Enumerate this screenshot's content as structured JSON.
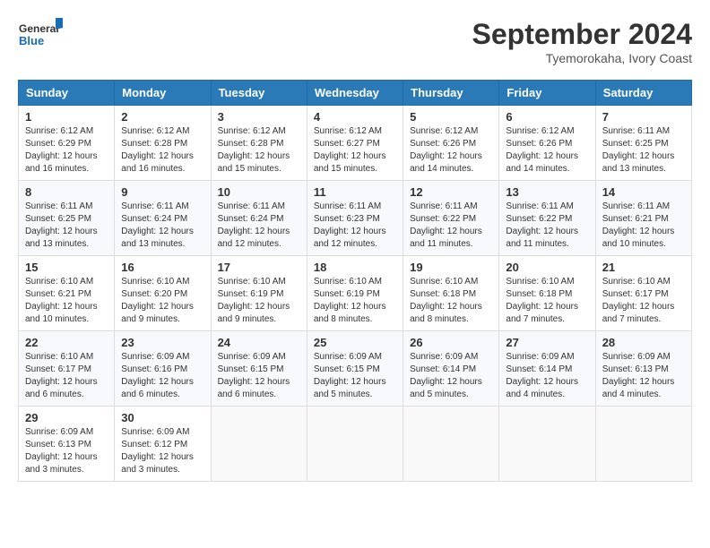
{
  "header": {
    "logo_line1": "General",
    "logo_line2": "Blue",
    "main_title": "September 2024",
    "subtitle": "Tyemorokaha, Ivory Coast"
  },
  "calendar": {
    "days_of_week": [
      "Sunday",
      "Monday",
      "Tuesday",
      "Wednesday",
      "Thursday",
      "Friday",
      "Saturday"
    ],
    "weeks": [
      [
        {
          "day": "1",
          "info": "Sunrise: 6:12 AM\nSunset: 6:29 PM\nDaylight: 12 hours\nand 16 minutes."
        },
        {
          "day": "2",
          "info": "Sunrise: 6:12 AM\nSunset: 6:28 PM\nDaylight: 12 hours\nand 16 minutes."
        },
        {
          "day": "3",
          "info": "Sunrise: 6:12 AM\nSunset: 6:28 PM\nDaylight: 12 hours\nand 15 minutes."
        },
        {
          "day": "4",
          "info": "Sunrise: 6:12 AM\nSunset: 6:27 PM\nDaylight: 12 hours\nand 15 minutes."
        },
        {
          "day": "5",
          "info": "Sunrise: 6:12 AM\nSunset: 6:26 PM\nDaylight: 12 hours\nand 14 minutes."
        },
        {
          "day": "6",
          "info": "Sunrise: 6:12 AM\nSunset: 6:26 PM\nDaylight: 12 hours\nand 14 minutes."
        },
        {
          "day": "7",
          "info": "Sunrise: 6:11 AM\nSunset: 6:25 PM\nDaylight: 12 hours\nand 13 minutes."
        }
      ],
      [
        {
          "day": "8",
          "info": "Sunrise: 6:11 AM\nSunset: 6:25 PM\nDaylight: 12 hours\nand 13 minutes."
        },
        {
          "day": "9",
          "info": "Sunrise: 6:11 AM\nSunset: 6:24 PM\nDaylight: 12 hours\nand 13 minutes."
        },
        {
          "day": "10",
          "info": "Sunrise: 6:11 AM\nSunset: 6:24 PM\nDaylight: 12 hours\nand 12 minutes."
        },
        {
          "day": "11",
          "info": "Sunrise: 6:11 AM\nSunset: 6:23 PM\nDaylight: 12 hours\nand 12 minutes."
        },
        {
          "day": "12",
          "info": "Sunrise: 6:11 AM\nSunset: 6:22 PM\nDaylight: 12 hours\nand 11 minutes."
        },
        {
          "day": "13",
          "info": "Sunrise: 6:11 AM\nSunset: 6:22 PM\nDaylight: 12 hours\nand 11 minutes."
        },
        {
          "day": "14",
          "info": "Sunrise: 6:11 AM\nSunset: 6:21 PM\nDaylight: 12 hours\nand 10 minutes."
        }
      ],
      [
        {
          "day": "15",
          "info": "Sunrise: 6:10 AM\nSunset: 6:21 PM\nDaylight: 12 hours\nand 10 minutes."
        },
        {
          "day": "16",
          "info": "Sunrise: 6:10 AM\nSunset: 6:20 PM\nDaylight: 12 hours\nand 9 minutes."
        },
        {
          "day": "17",
          "info": "Sunrise: 6:10 AM\nSunset: 6:19 PM\nDaylight: 12 hours\nand 9 minutes."
        },
        {
          "day": "18",
          "info": "Sunrise: 6:10 AM\nSunset: 6:19 PM\nDaylight: 12 hours\nand 8 minutes."
        },
        {
          "day": "19",
          "info": "Sunrise: 6:10 AM\nSunset: 6:18 PM\nDaylight: 12 hours\nand 8 minutes."
        },
        {
          "day": "20",
          "info": "Sunrise: 6:10 AM\nSunset: 6:18 PM\nDaylight: 12 hours\nand 7 minutes."
        },
        {
          "day": "21",
          "info": "Sunrise: 6:10 AM\nSunset: 6:17 PM\nDaylight: 12 hours\nand 7 minutes."
        }
      ],
      [
        {
          "day": "22",
          "info": "Sunrise: 6:10 AM\nSunset: 6:17 PM\nDaylight: 12 hours\nand 6 minutes."
        },
        {
          "day": "23",
          "info": "Sunrise: 6:09 AM\nSunset: 6:16 PM\nDaylight: 12 hours\nand 6 minutes."
        },
        {
          "day": "24",
          "info": "Sunrise: 6:09 AM\nSunset: 6:15 PM\nDaylight: 12 hours\nand 6 minutes."
        },
        {
          "day": "25",
          "info": "Sunrise: 6:09 AM\nSunset: 6:15 PM\nDaylight: 12 hours\nand 5 minutes."
        },
        {
          "day": "26",
          "info": "Sunrise: 6:09 AM\nSunset: 6:14 PM\nDaylight: 12 hours\nand 5 minutes."
        },
        {
          "day": "27",
          "info": "Sunrise: 6:09 AM\nSunset: 6:14 PM\nDaylight: 12 hours\nand 4 minutes."
        },
        {
          "day": "28",
          "info": "Sunrise: 6:09 AM\nSunset: 6:13 PM\nDaylight: 12 hours\nand 4 minutes."
        }
      ],
      [
        {
          "day": "29",
          "info": "Sunrise: 6:09 AM\nSunset: 6:13 PM\nDaylight: 12 hours\nand 3 minutes."
        },
        {
          "day": "30",
          "info": "Sunrise: 6:09 AM\nSunset: 6:12 PM\nDaylight: 12 hours\nand 3 minutes."
        },
        {
          "day": "",
          "info": ""
        },
        {
          "day": "",
          "info": ""
        },
        {
          "day": "",
          "info": ""
        },
        {
          "day": "",
          "info": ""
        },
        {
          "day": "",
          "info": ""
        }
      ]
    ]
  }
}
